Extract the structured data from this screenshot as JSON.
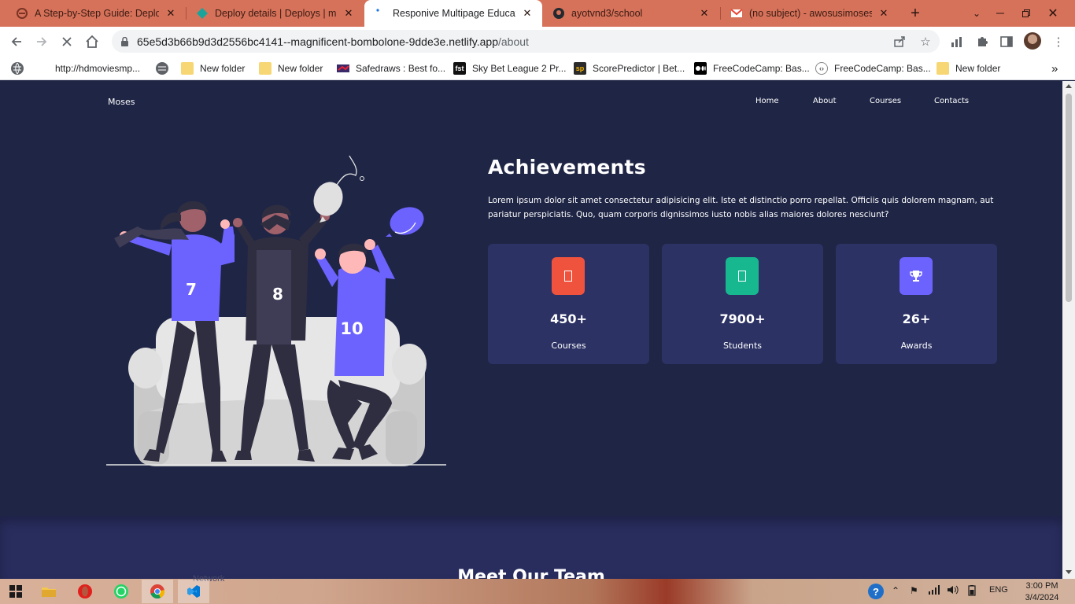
{
  "browser": {
    "tabs": [
      {
        "title": "A Step-by-Step Guide: Deployi",
        "icon": "quote-tag-icon",
        "active": false
      },
      {
        "title": "Deploy details | Deploys | mag",
        "icon": "netlify-icon",
        "active": false
      },
      {
        "title": "Responive Multipage Educatio",
        "icon": "loading-dot-icon",
        "active": true
      },
      {
        "title": "ayotvnd3/school",
        "icon": "github-icon",
        "active": false
      },
      {
        "title": "(no subject) - awosusimoses@",
        "icon": "gmail-icon",
        "active": false
      }
    ],
    "url_host": "65e5d3b66b9d3d2556bc4141--magnificent-bombolone-9dde3e.netlify.app",
    "url_path": "/about",
    "bookmarks": [
      {
        "label": "http://hdmoviesmp...",
        "icon": "globe-icon"
      },
      {
        "label": "New folder",
        "icon": "folder-icon"
      },
      {
        "label": "New folder",
        "icon": "folder-icon"
      },
      {
        "label": "Safedraws : Best fo...",
        "icon": "safedraws-icon"
      },
      {
        "label": "Sky Bet League 2 Pr...",
        "icon": "fst-icon",
        "badge": "fst"
      },
      {
        "label": "ScorePredictor | Bet...",
        "icon": "sp-icon",
        "badge": "sp"
      },
      {
        "label": "FreeCodeCamp: Bas...",
        "icon": "medium-icon"
      },
      {
        "label": "FreeCodeCamp: Bas...",
        "icon": "code-icon"
      },
      {
        "label": "New folder",
        "icon": "folder-icon"
      }
    ]
  },
  "site": {
    "logo": "Moses",
    "nav": [
      "Home",
      "About",
      "Courses",
      "Contacts"
    ],
    "achievements": {
      "title": "Achievements",
      "description": "Lorem ipsum dolor sit amet consectetur adipisicing elit. Iste et distinctio porro repellat. Officiis quis dolorem magnam, aut pariatur perspiciatis. Quo, quam corporis dignissimos iusto nobis alias maiores dolores nesciunt?"
    },
    "stats": [
      {
        "number": "450+",
        "label": "Courses",
        "icon": "book-icon",
        "color": "#f0533d"
      },
      {
        "number": "7900+",
        "label": "Students",
        "icon": "user-graduate-icon",
        "color": "#17b890"
      },
      {
        "number": "26+",
        "label": "Awards",
        "icon": "trophy-icon",
        "color": "#6c63ff"
      }
    ],
    "illustration": {
      "jersey_numbers": [
        "7",
        "8",
        "10"
      ]
    },
    "team_title": "Meet Our Team"
  },
  "taskbar": {
    "ghost_label": "Network",
    "language": "ENG",
    "time": "3:00 PM",
    "date": "3/4/2024"
  },
  "colors": {
    "page_bg": "#1f2545",
    "card_bg": "#2c3264",
    "accent_purple": "#6c63ff",
    "tab_strip": "#d6725a"
  }
}
